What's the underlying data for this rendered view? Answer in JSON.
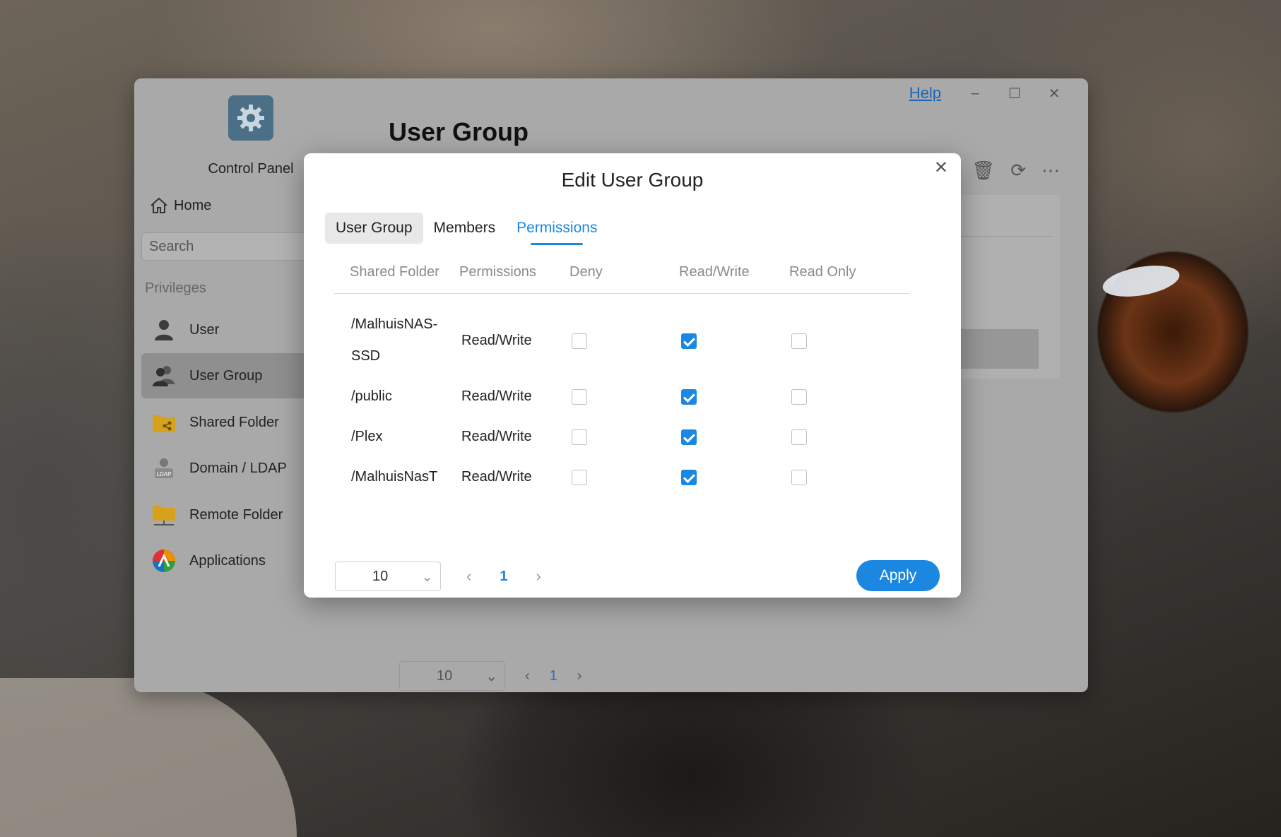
{
  "window": {
    "app_name": "Control Panel",
    "page_title": "User Group",
    "help_label": "Help",
    "minimize_glyph": "–",
    "maximize_glyph": "☐",
    "close_glyph": "✕"
  },
  "sidebar": {
    "home_label": "Home",
    "search_placeholder": "Search",
    "section_label": "Privileges",
    "items": [
      {
        "label": "User",
        "icon": "user-icon"
      },
      {
        "label": "User Group",
        "icon": "user-group-icon",
        "active": true
      },
      {
        "label": "Shared Folder",
        "icon": "shared-folder-icon"
      },
      {
        "label": "Domain / LDAP",
        "icon": "ldap-icon"
      },
      {
        "label": "Remote Folder",
        "icon": "remote-folder-icon"
      },
      {
        "label": "Applications",
        "icon": "applications-icon"
      }
    ]
  },
  "background_pager": {
    "page_size": "10",
    "current_page": "1"
  },
  "dialog": {
    "title": "Edit User Group",
    "close_glyph": "✕",
    "tabs": [
      "User Group",
      "Members",
      "Permissions"
    ],
    "active_tab": "Permissions",
    "columns": [
      "Shared Folder",
      "Permissions",
      "Deny",
      "Read/Write",
      "Read Only"
    ],
    "rows": [
      {
        "folder_line1": "/MalhuisNAS-",
        "folder_line2": "SSD",
        "permission": "Read/Write",
        "deny": false,
        "read_write": true,
        "read_only": false
      },
      {
        "folder_line1": "/public",
        "folder_line2": "",
        "permission": "Read/Write",
        "deny": false,
        "read_write": true,
        "read_only": false
      },
      {
        "folder_line1": "/Plex",
        "folder_line2": "",
        "permission": "Read/Write",
        "deny": false,
        "read_write": true,
        "read_only": false
      },
      {
        "folder_line1": "/MalhuisNasT",
        "folder_line2": "",
        "permission": "Read/Write",
        "deny": false,
        "read_write": true,
        "read_only": false
      }
    ],
    "pager": {
      "page_size": "10",
      "current_page": "1"
    },
    "apply_label": "Apply"
  },
  "colors": {
    "accent": "#1b87e0",
    "window_bg": "#a9a9a9"
  }
}
